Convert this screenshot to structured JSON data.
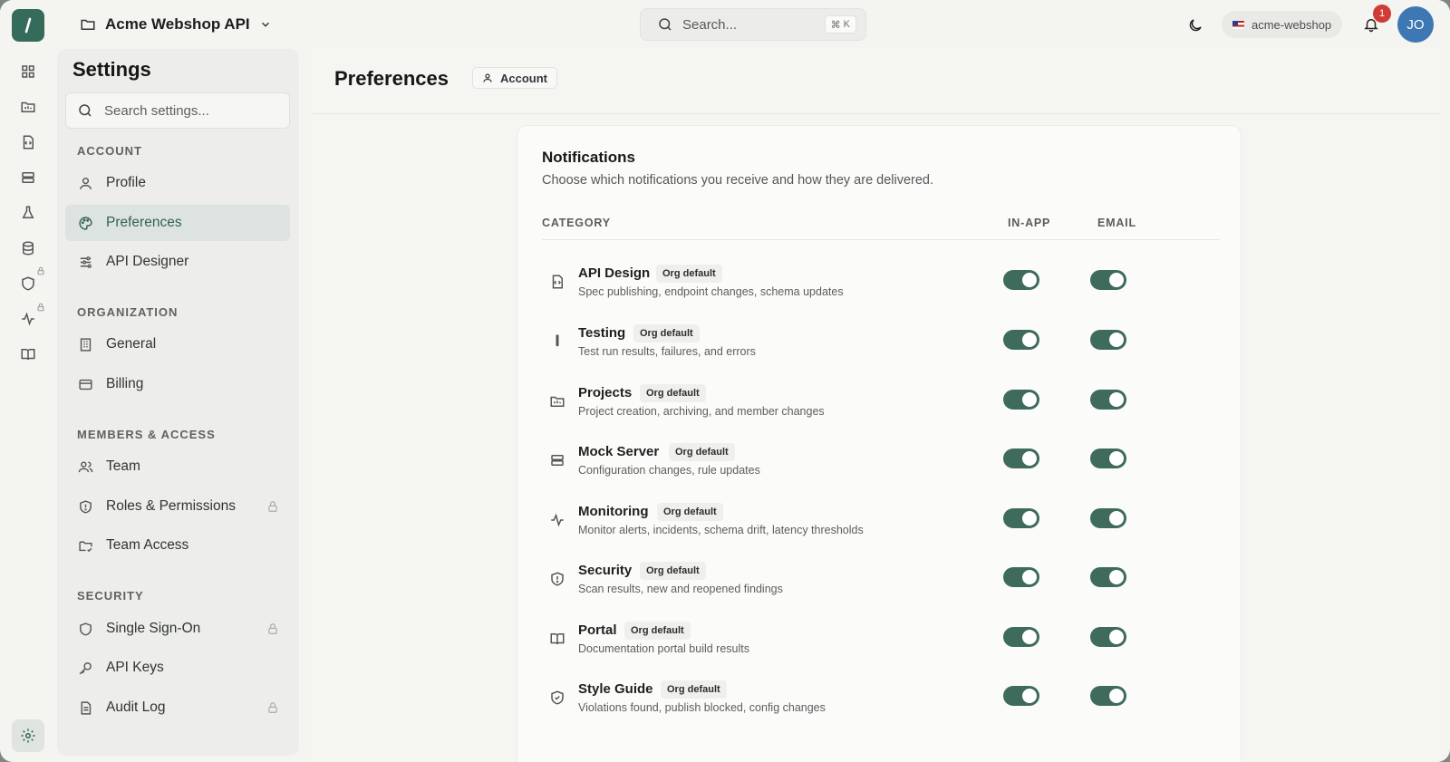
{
  "topbar": {
    "project_name": "Acme Webshop API",
    "search_placeholder": "Search...",
    "search_shortcut_symbol": "⌘",
    "search_shortcut_key": "K",
    "workspace": "acme-webshop",
    "notification_count": "1",
    "avatar_initials": "JO"
  },
  "rail": {
    "items": [
      "dashboard-icon",
      "projects-icon",
      "api-design-icon",
      "mock-server-icon",
      "testing-icon",
      "database-icon",
      "security-icon",
      "monitoring-icon",
      "portal-icon"
    ],
    "settings_icon": "gear-icon"
  },
  "sidebar": {
    "title": "Settings",
    "search_placeholder": "Search settings...",
    "sections": [
      {
        "label": "ACCOUNT",
        "items": [
          {
            "label": "Profile",
            "icon": "user-icon"
          },
          {
            "label": "Preferences",
            "icon": "palette-icon",
            "active": true
          },
          {
            "label": "API Designer",
            "icon": "sliders-icon"
          }
        ]
      },
      {
        "label": "ORGANIZATION",
        "items": [
          {
            "label": "General",
            "icon": "building-icon"
          },
          {
            "label": "Billing",
            "icon": "credit-card-icon"
          }
        ]
      },
      {
        "label": "MEMBERS & ACCESS",
        "items": [
          {
            "label": "Team",
            "icon": "users-icon"
          },
          {
            "label": "Roles & Permissions",
            "icon": "shield-icon",
            "locked": true
          },
          {
            "label": "Team Access",
            "icon": "folder-access-icon"
          }
        ]
      },
      {
        "label": "SECURITY",
        "items": [
          {
            "label": "Single Sign-On",
            "icon": "shield-icon",
            "locked": true
          },
          {
            "label": "API Keys",
            "icon": "key-icon"
          },
          {
            "label": "Audit Log",
            "icon": "document-icon",
            "locked": true
          }
        ]
      }
    ]
  },
  "main": {
    "title": "Preferences",
    "breadcrumb": "Account",
    "card": {
      "title": "Notifications",
      "description": "Choose which notifications you receive and how they are delivered.",
      "columns": {
        "category": "CATEGORY",
        "in_app": "IN-APP",
        "email": "EMAIL"
      },
      "rows": [
        {
          "name": "API Design",
          "tag": "Org default",
          "desc": "Spec publishing, endpoint changes, schema updates",
          "icon": "api-design-icon",
          "in_app": true,
          "email": true
        },
        {
          "name": "Testing",
          "tag": "Org default",
          "desc": "Test run results, failures, and errors",
          "icon": "test-tube-icon",
          "in_app": true,
          "email": true
        },
        {
          "name": "Projects",
          "tag": "Org default",
          "desc": "Project creation, archiving, and member changes",
          "icon": "folder-icon",
          "in_app": true,
          "email": true
        },
        {
          "name": "Mock Server",
          "tag": "Org default",
          "desc": "Configuration changes, rule updates",
          "icon": "server-icon",
          "in_app": true,
          "email": true
        },
        {
          "name": "Monitoring",
          "tag": "Org default",
          "desc": "Monitor alerts, incidents, schema drift, latency thresholds",
          "icon": "activity-icon",
          "in_app": true,
          "email": true
        },
        {
          "name": "Security",
          "tag": "Org default",
          "desc": "Scan results, new and reopened findings",
          "icon": "shield-alert-icon",
          "in_app": true,
          "email": true
        },
        {
          "name": "Portal",
          "tag": "Org default",
          "desc": "Documentation portal build results",
          "icon": "book-icon",
          "in_app": true,
          "email": true
        },
        {
          "name": "Style Guide",
          "tag": "Org default",
          "desc": "Violations found, publish blocked, config changes",
          "icon": "shield-check-icon",
          "in_app": true,
          "email": true
        }
      ]
    }
  },
  "colors": {
    "accent": "#3e6b5c",
    "active_bg": "#dde3e0",
    "badge": "#d13b36",
    "avatar": "#3d78b5"
  }
}
